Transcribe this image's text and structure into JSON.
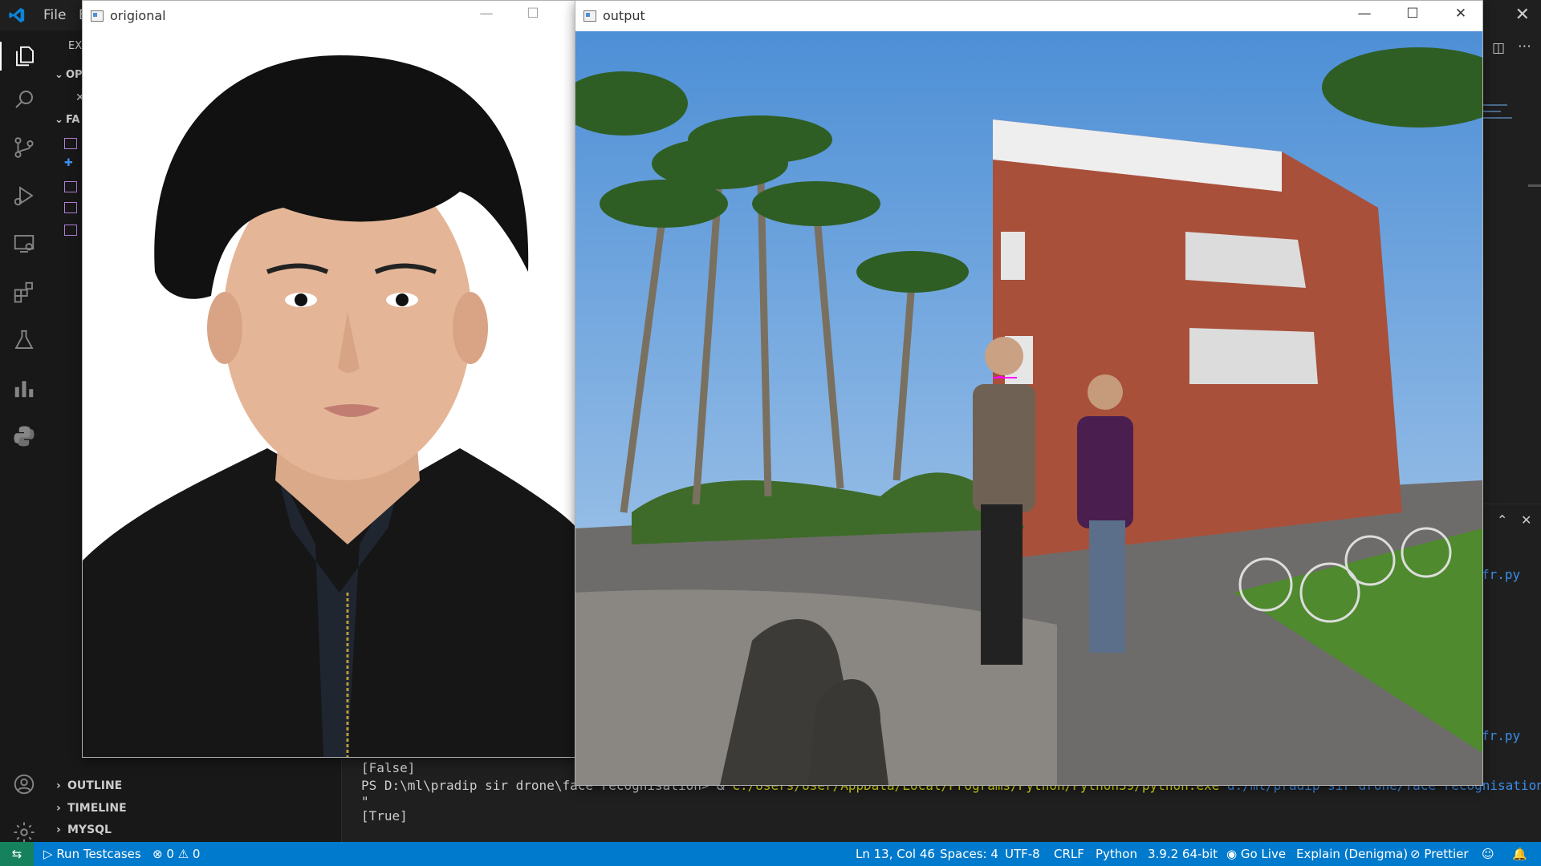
{
  "vscode": {
    "menu": {
      "file": "File",
      "edit": "E"
    },
    "sidebar": {
      "explorer_label": "EX",
      "section_open": "OP",
      "section_folder": "FA",
      "sections": {
        "outline": "OUTLINE",
        "timeline": "TIMELINE",
        "mysql": "MYSQL"
      }
    },
    "terminal": {
      "line1": "[False]",
      "line2_prompt": "PS D:\\ml\\pradip sir drone\\face recognisation> & ",
      "line2_exe": "C:/Users/User/AppData/Local/Programs/Python/Python39/python.exe",
      "line2_path": " d:/ml/pradip sir drone/face recognisation/fr.py",
      "line3": "\"",
      "line4": "[True]"
    },
    "right_panel": {
      "file_ref_1": "fr.py",
      "file_ref_2": "fr.py"
    },
    "statusbar": {
      "run_testcases": "Run Testcases",
      "errors": "0",
      "warnings": "0",
      "cursor": "Ln 13, Col 46",
      "spaces": "Spaces: 4",
      "encoding": "UTF-8",
      "eol": "CRLF",
      "language": "Python",
      "interpreter": "3.9.2 64-bit",
      "go_live": "Go Live",
      "explain": "Explain (Denigma)",
      "prettier": "Prettier"
    },
    "colors": {
      "statusbar": "#007acc",
      "background": "#1e1e1e",
      "sidebar": "#181818"
    }
  },
  "windows": {
    "original": {
      "title": "origional"
    },
    "output": {
      "title": "output"
    }
  }
}
